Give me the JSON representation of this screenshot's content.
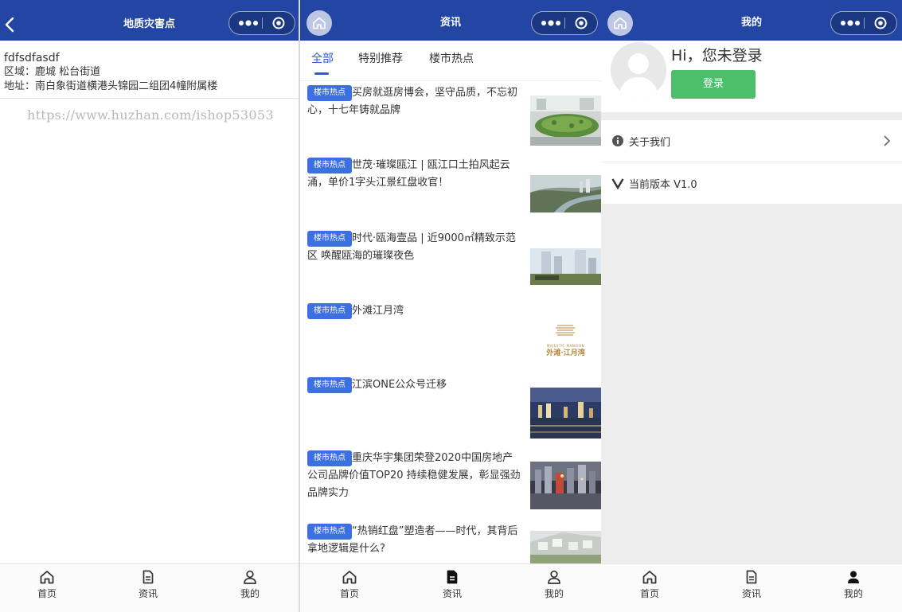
{
  "left_screen": {
    "title": "地质灾害点",
    "name": "fdfsdfasdf",
    "region": "区域：鹿城 松台街道",
    "address": "地址：南白象街道横港头锦园二组团4幢附属楼",
    "watermark": "https://www.huzhan.com/ishop53053"
  },
  "middle_screen": {
    "title": "资讯",
    "tabs": [
      {
        "label": "全部",
        "active": true
      },
      {
        "label": "特别推荐",
        "active": false
      },
      {
        "label": "楼市热点",
        "active": false
      }
    ],
    "articles": [
      {
        "tag": "楼市热点",
        "title": "买房就逛房博会，坚守品质，不忘初心，十七年铸就品牌"
      },
      {
        "tag": "楼市热点",
        "title": "世茂·璀璨瓯江 | 瓯江口土拍风起云涌，单价1字头江景红盘收官！"
      },
      {
        "tag": "楼市热点",
        "title": "时代·瓯海壹品 | 近9000㎡精致示范区 唤醒瓯海的璀璨夜色"
      },
      {
        "tag": "楼市热点",
        "title": "外滩江月湾"
      },
      {
        "tag": "楼市热点",
        "title": "江滨ONE公众号迁移"
      },
      {
        "tag": "楼市热点",
        "title": "重庆华宇集团荣登2020中国房地产公司品牌价值TOP20 持续稳健发展，彰显强劲品牌实力"
      },
      {
        "tag": "楼市热点",
        "title": "“热销红盘”塑造者——时代，其背后拿地逻辑是什么?"
      }
    ],
    "logo_text_en": "MAJESTIC MANSION",
    "logo_text_cn": "外滩·江月湾"
  },
  "right_screen": {
    "title": "我的",
    "greeting": "Hi，您未登录",
    "login_label": "登录",
    "menu": [
      {
        "icon": "info-icon",
        "label": "关于我们"
      },
      {
        "icon": "version-icon",
        "label": "当前版本 V1.0"
      }
    ]
  },
  "tabbar": [
    {
      "icon": "home-icon",
      "label": "首页"
    },
    {
      "icon": "document-icon",
      "label": "资讯"
    },
    {
      "icon": "user-icon",
      "label": "我的"
    }
  ],
  "colors": {
    "navbar": "#2345a3",
    "accent": "#2d5bd7",
    "tag": "#3c6fe0",
    "login_button": "#4bbf6b"
  }
}
